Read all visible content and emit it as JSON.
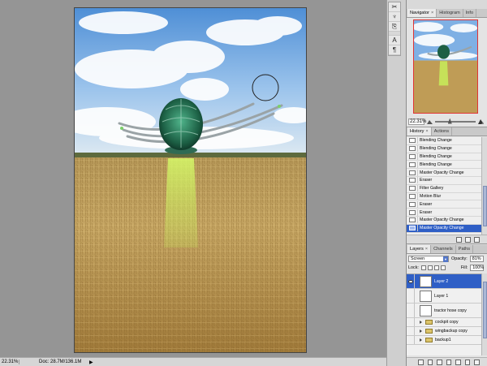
{
  "status": {
    "zoom": "22.31%",
    "doc": "Doc: 28.7M/136.1M",
    "arrow": "▶"
  },
  "tools": [
    "✂",
    "♆",
    "⎘",
    "A",
    "¶"
  ],
  "navigator": {
    "tabs": [
      "Navigator",
      "Histogram",
      "Info"
    ],
    "zoom": "22.31%",
    "zoom_fraction": 0.35
  },
  "history": {
    "tabs": [
      "History",
      "Actions"
    ],
    "items": [
      "Blending Change",
      "Blending Change",
      "Blending Change",
      "Blending Change",
      "Master Opacity Change",
      "Eraser",
      "Filter Gallery",
      "Motion Blur",
      "Eraser",
      "Eraser",
      "Master Opacity Change",
      "Master Opacity Change"
    ],
    "selected_index": 11
  },
  "layers": {
    "tabs": [
      "Layers",
      "Channels",
      "Paths"
    ],
    "blend_mode": "Screen",
    "opacity_label": "Opacity:",
    "opacity_value": "81%",
    "lock_label": "Lock:",
    "fill_label": "Fill:",
    "fill_value": "100%",
    "items": [
      {
        "name": "Layer 2",
        "type": "layer",
        "visible": true,
        "selected": true
      },
      {
        "name": "Layer 1",
        "type": "layer",
        "visible": false,
        "selected": false
      },
      {
        "name": "tractor hose copy",
        "type": "layer",
        "visible": false,
        "selected": false
      },
      {
        "name": "cockpit copy",
        "type": "group",
        "visible": false,
        "selected": false
      },
      {
        "name": "wingbackup copy",
        "type": "group",
        "visible": false,
        "selected": false
      },
      {
        "name": "backup1",
        "type": "group",
        "visible": false,
        "selected": false
      }
    ]
  },
  "colors": {
    "selection": "#2f5fc6",
    "nav_frame": "#e03434",
    "beam": "#c8f25a"
  }
}
